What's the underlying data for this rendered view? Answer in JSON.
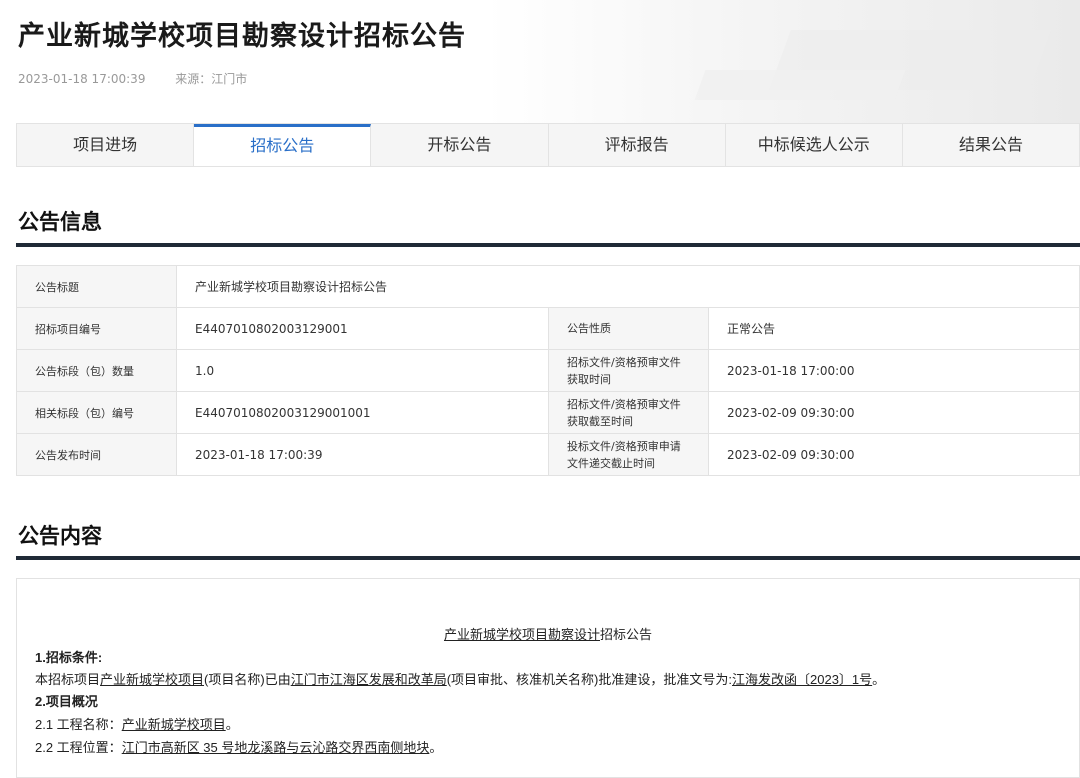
{
  "header": {
    "title": "产业新城学校项目勘察设计招标公告",
    "date": "2023-01-18 17:00:39",
    "source": "来源：江门市"
  },
  "tabs": [
    {
      "label": "项目进场"
    },
    {
      "label": "招标公告"
    },
    {
      "label": "开标公告"
    },
    {
      "label": "评标报告"
    },
    {
      "label": "中标候选人公示"
    },
    {
      "label": "结果公告"
    }
  ],
  "info_section": {
    "title": "公告信息",
    "rows": {
      "title_key": "公告标题",
      "title_val": "产业新城学校项目勘察设计招标公告",
      "code_key": "招标项目编号",
      "code_val": "E4407010802003129001",
      "nature_key": "公告性质",
      "nature_val": "正常公告",
      "count_key": "公告标段（包）数量",
      "count_val": "1.0",
      "get_key_1": "招标文件/资格预审文件",
      "get_key_2": "获取时间",
      "get_val": "2023-01-18 17:00:00",
      "pkg_key": "相关标段（包）编号",
      "pkg_val": "E4407010802003129001001",
      "deadline_key_1": "招标文件/资格预审文件",
      "deadline_key_2": "获取截至时间",
      "deadline_val": "2023-02-09 09:30:00",
      "pub_key": "公告发布时间",
      "pub_val": "2023-01-18 17:00:39",
      "submit_key_1": "投标文件/资格预审申请",
      "submit_key_2": "文件递交截止时间",
      "submit_val": "2023-02-09 09:30:00"
    }
  },
  "content_section": {
    "title": "公告内容",
    "doc_title_link": "产业新城学校项目勘察设计",
    "doc_title_rest": "招标公告",
    "h1": "1.招标条件:",
    "p1_a": "本招标项目",
    "p1_link1": "产业新城学校项目",
    "p1_b": "(项目名称)已由",
    "p1_link2": "江门市江海区发展和改革局",
    "p1_c": "(项目审批、核准机关名称)批准建设，批准文号为:",
    "p1_link3": "江海发改函〔2023〕1号",
    "p1_d": "。",
    "h2": "2.项目概况",
    "l21_a": "2.1 工程名称：",
    "l21_link": "产业新城学校项目",
    "l21_b": "。",
    "l22_a": "2.2 工程位置：",
    "l22_link": "江门市高新区 35 号地龙溪路与云沁路交界西南侧地块",
    "l22_b": "。"
  }
}
